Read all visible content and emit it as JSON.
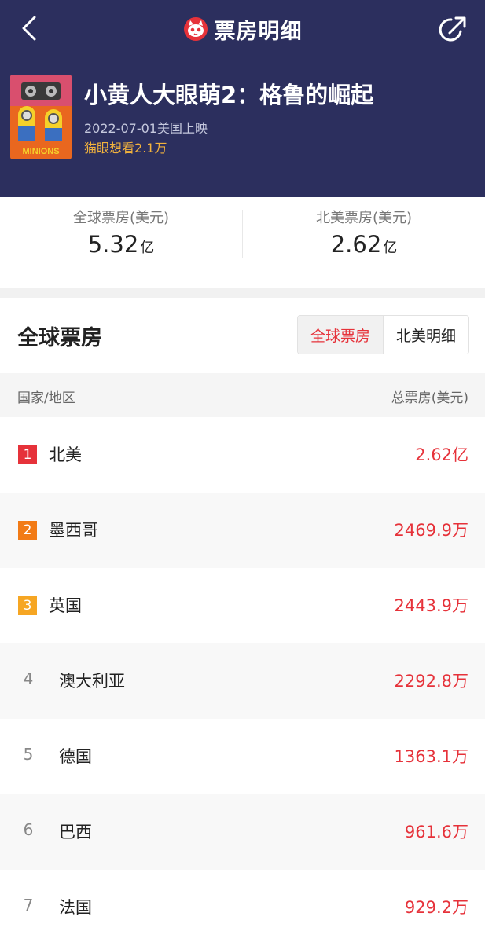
{
  "header": {
    "title": "票房明细",
    "movie_title": "小黄人大眼萌2：格鲁的崛起",
    "release": "2022-07-01美国上映",
    "want_prefix": "猫眼想看",
    "want_count": "2.1万",
    "poster_text": "MINIONS",
    "colors": {
      "background": "#2c2f5e",
      "accent": "#f3b33d"
    }
  },
  "summary": {
    "global": {
      "label": "全球票房(美元)",
      "value": "5.32",
      "unit": "亿"
    },
    "north_america": {
      "label": "北美票房(美元)",
      "value": "2.62",
      "unit": "亿"
    }
  },
  "section": {
    "title": "全球票房",
    "tabs": [
      {
        "label": "全球票房",
        "active": true
      },
      {
        "label": "北美明细",
        "active": false
      }
    ]
  },
  "table": {
    "col_region": "国家/地区",
    "col_total": "总票房(美元)",
    "rows": [
      {
        "rank": "1",
        "country": "北美",
        "value": "2.62亿",
        "badge_color": "#e6323a"
      },
      {
        "rank": "2",
        "country": "墨西哥",
        "value": "2469.9万",
        "badge_color": "#f27b16"
      },
      {
        "rank": "3",
        "country": "英国",
        "value": "2443.9万",
        "badge_color": "#f6a623"
      },
      {
        "rank": "4",
        "country": "澳大利亚",
        "value": "2292.8万"
      },
      {
        "rank": "5",
        "country": "德国",
        "value": "1363.1万"
      },
      {
        "rank": "6",
        "country": "巴西",
        "value": "961.6万"
      },
      {
        "rank": "7",
        "country": "法国",
        "value": "929.2万"
      }
    ]
  }
}
